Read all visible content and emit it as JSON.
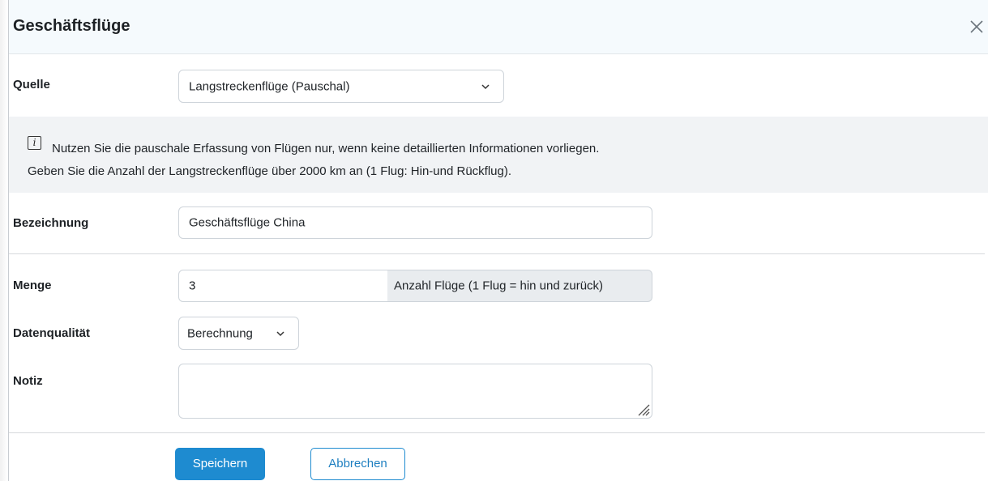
{
  "modal": {
    "title": "Geschäftsflüge",
    "close_icon": "close-icon"
  },
  "form": {
    "quelle": {
      "label": "Quelle",
      "value": "Langstreckenflüge (Pauschal)"
    },
    "info": {
      "icon": "info-icon",
      "icon_glyph": "i",
      "line1": "Nutzen Sie die pauschale Erfassung von Flügen nur, wenn keine detaillierten Informationen vorliegen.",
      "line2": "Geben Sie die Anzahl der Langstreckenflüge über 2000 km an (1 Flug: Hin-und Rückflug)."
    },
    "bezeichnung": {
      "label": "Bezeichnung",
      "value": "Geschäftsflüge China"
    },
    "menge": {
      "label": "Menge",
      "value": "3",
      "unit": "Anzahl Flüge (1 Flug = hin und zurück)"
    },
    "datenqualitaet": {
      "label": "Datenqualität",
      "value": "Berechnung"
    },
    "notiz": {
      "label": "Notiz",
      "value": ""
    }
  },
  "buttons": {
    "save": "Speichern",
    "cancel": "Abbrechen"
  },
  "colors": {
    "primary": "#1e8bd0",
    "header_bg": "#f5fafd",
    "info_bg": "#f1f3f5",
    "addon_bg": "#e9ecef"
  }
}
